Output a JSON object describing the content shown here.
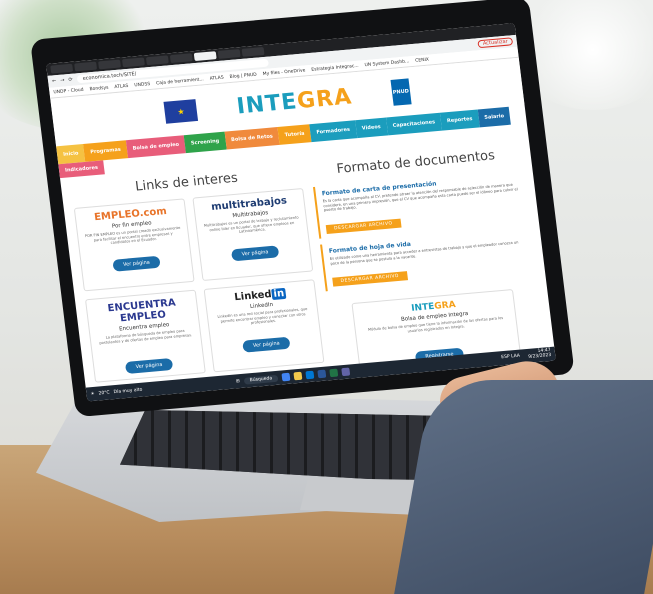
{
  "browser": {
    "url": "economica.tech/SITE/",
    "restart_label": "Actualizar",
    "bookmarks": [
      "UNDP - Cloud",
      "Bondsys",
      "ATLAS",
      "UNDSS",
      "Caja de herramient...",
      "ATLAS",
      "Blog | PNUD",
      "My files - OneDrive",
      "Estrategia Integrac...",
      "UN System Dashb...",
      "CENIX"
    ]
  },
  "header": {
    "logo_main": "INTE",
    "logo_accent": "GRA",
    "undp_label": "PNUD"
  },
  "nav": {
    "row1": [
      {
        "label": "Inicio",
        "color": "#f5c242"
      },
      {
        "label": "Programas",
        "color": "#f5a11b"
      },
      {
        "label": "Bolsa de empleo",
        "color": "#e85d7a"
      },
      {
        "label": "Screening",
        "color": "#2fa34a"
      },
      {
        "label": "Bolsa de Retos",
        "color": "#f08a3c"
      },
      {
        "label": "Tutoría",
        "color": "#f5a11b"
      },
      {
        "label": "Formadores",
        "color": "#1b9dbd"
      },
      {
        "label": "Videos",
        "color": "#1b9dbd"
      },
      {
        "label": "Capacitaciones",
        "color": "#1b9dbd"
      },
      {
        "label": "Reportes",
        "color": "#1b9dbd"
      },
      {
        "label": "Salario",
        "color": "#1b6ca8"
      }
    ],
    "row2": [
      {
        "label": "Indicadores",
        "color": "#e85d7a"
      }
    ]
  },
  "links_section": {
    "title": "Links de interes",
    "cards": [
      {
        "logo": "EMPLEO.com",
        "title": "Por fin empleo",
        "desc": "POR FIN EMPLEO es un portal creado exclusivamente para facilitar el encuentro entre empresas y candidatos en el Ecuador.",
        "button": "Ver página"
      },
      {
        "logo": "multitrabajos",
        "title": "Multitrabajos",
        "desc": "Multitrabajos es un portal de trabajo y reclutamiento online líder en Ecuador, que ofrece empleos en Latinoamérica.",
        "button": "Ver página"
      },
      {
        "logo": "ENCUENTRA EMPLEO",
        "title": "Encuentra empleo",
        "desc": "La plataforma de búsqueda de empleo para postulantes y de ofertas de empleo para empresas.",
        "button": "Ver página"
      },
      {
        "logo": "Linked",
        "logo_badge": "in",
        "title": "LinkedIn",
        "desc": "LinkedIn es una red social para profesionales, que permite encontrar empleo y conectar con otros profesionales.",
        "button": "Ver página"
      }
    ]
  },
  "docs_section": {
    "title": "Formato de documentos",
    "items": [
      {
        "title": "Formato de carta de presentación",
        "desc": "Es la carta que acompaña al CV, pretende atraer la atención del responsable de selección de manera que considere, en una primera impresión, que el CV que acompaña esta carta puede ser el idóneo para cubrir el puesto de trabajo.",
        "button": "DESCARGAR ARCHIVO"
      },
      {
        "title": "Formato de hoja de vida",
        "desc": "Es utilizado como una herramienta para acceder a entrevistas de trabajo y que el empleador conozca un poco de la persona que se postula a la vacante.",
        "button": "DESCARGAR ARCHIVO"
      }
    ],
    "bolsa": {
      "logo_main": "INTE",
      "logo_accent": "GRA",
      "title": "Bolsa de empleo Integra",
      "desc": "Módulo de bolsa de empleo que tiene la información de las ofertas para los usuarios registrados en Integra.",
      "button": "Registrarse"
    }
  },
  "taskbar": {
    "weather_temp": "20°C",
    "weather_desc": "Día muy alto",
    "search": "Búsqueda",
    "lang": "ESP LAA",
    "time": "14:47",
    "date": "9/23/2023"
  }
}
